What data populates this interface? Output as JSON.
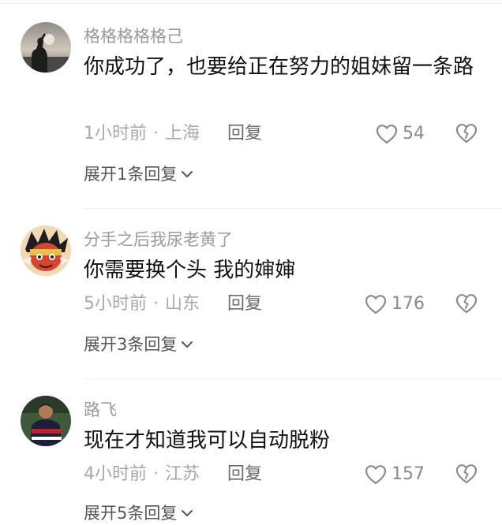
{
  "comments": [
    {
      "username": "格格格格格己",
      "text": "你成功了，也要给正在努力的姐妹留一条路",
      "time": "1小时前",
      "separator": "·",
      "location": "上海",
      "reply_label": "回复",
      "likes": "54",
      "expand_label": "展开1条回复"
    },
    {
      "username": "分手之后我尿老黄了",
      "text": "你需要换个头 我的婶婶",
      "time": "5小时前",
      "separator": "·",
      "location": "山东",
      "reply_label": "回复",
      "likes": "176",
      "expand_label": "展开3条回复"
    },
    {
      "username": "路飞",
      "text": "现在才知道我可以自动脱粉",
      "time": "4小时前",
      "separator": "·",
      "location": "江苏",
      "reply_label": "回复",
      "likes": "157",
      "expand_label": "展开5条回复"
    }
  ],
  "icons": {
    "like": "heart-outline-icon",
    "dislike": "broken-heart-icon",
    "expand": "chevron-down-icon"
  },
  "colors": {
    "username": "#9a9a9a",
    "meta": "#a8a8a8",
    "text": "#111111"
  }
}
